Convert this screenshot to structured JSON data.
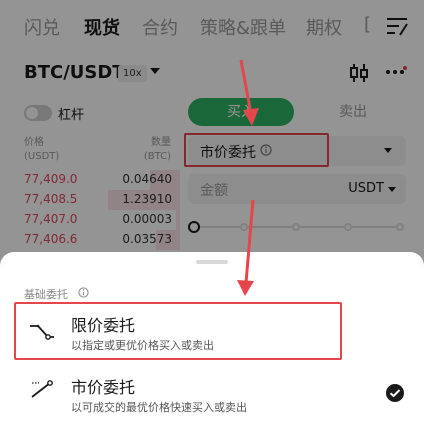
{
  "tabs": [
    "闪兑",
    "现货",
    "合约",
    "策略&跟单",
    "期权",
    "["
  ],
  "active_tab": "现货",
  "pair": {
    "symbol": "BTC/USDT",
    "leverage": "10x"
  },
  "margin_toggle": {
    "label": "杠杆",
    "on": false
  },
  "order_book": {
    "price_label": "价格",
    "price_unit": "(USDT)",
    "qty_label": "数量",
    "qty_unit": "(BTC)",
    "asks": [
      {
        "price": "77,409.0",
        "qty": "0.04640"
      },
      {
        "price": "77,408.5",
        "qty": "1.23910"
      },
      {
        "price": "77,407.0",
        "qty": "0.00003"
      },
      {
        "price": "77,406.6",
        "qty": "0.03573"
      }
    ]
  },
  "trade_panel": {
    "buy_label": "买入",
    "sell_label": "卖出",
    "order_type": "市价委托",
    "amount_placeholder": "金额",
    "amount_unit": "USDT"
  },
  "sheet": {
    "title": "基础委托",
    "options": [
      {
        "title": "限价委托",
        "desc": "以指定或更优价格买入或卖出",
        "selected": false,
        "icon": "limit-order-icon"
      },
      {
        "title": "市价委托",
        "desc": "以可成交的最优价格快速买入或卖出",
        "selected": true,
        "icon": "market-order-icon"
      }
    ]
  },
  "colors": {
    "buy": "#2eb363",
    "ask_price": "#e2475a",
    "highlight_box": "#e5464c"
  }
}
